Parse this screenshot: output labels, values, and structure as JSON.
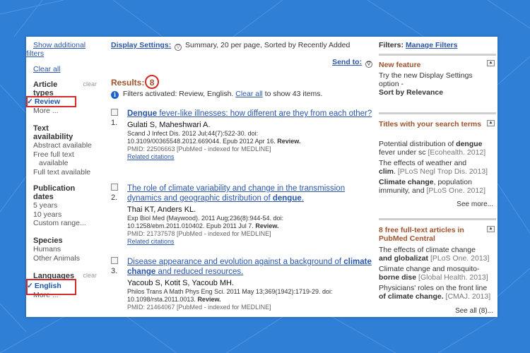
{
  "sidebar": {
    "show_additional": [
      "Show additional",
      "filters"
    ],
    "clear_all": "Clear all",
    "article_types": {
      "heading": [
        "Article",
        "types"
      ],
      "clear": "clear",
      "selected": "Review",
      "more": "More ..."
    },
    "text_availability": {
      "heading": [
        "Text",
        "availability"
      ],
      "items": [
        "Abstract available",
        "Free full text",
        "available",
        "Full text available"
      ]
    },
    "publication_dates": {
      "heading": [
        "Publication",
        "dates"
      ],
      "items": [
        "5 years",
        "10 years",
        "Custom range..."
      ]
    },
    "species": {
      "heading": "Species",
      "items": [
        "Humans",
        "Other Animals"
      ]
    },
    "languages": {
      "heading": "Languages",
      "clear": "clear",
      "selected": "English",
      "more": "More ..."
    },
    "check_mark": "✓"
  },
  "main": {
    "display_settings": {
      "label": "Display Settings:",
      "value": "Summary, 20 per page, Sorted by Recently Added"
    },
    "send_to": "Send to:",
    "results_label": "Results:",
    "results_count": "8",
    "filters_activated": "Filters activated: Review, English.",
    "clear_all": "Clear all",
    "show_all": "to show 43 items.",
    "results": [
      {
        "num": "1.",
        "title_html": "<b>Dengue</b> fever-like illnesses: how different are they from each other?",
        "authors": "Gulati S, Maheshwari A.",
        "cite1": "Scand J Infect Dis. 2012 Jul;44(7):522-30. doi:",
        "cite2": "10.3109/00365548.2012.669044. Epub 2012 Apr 16.",
        "cite_bold": "Review.",
        "pmid": "PMID: 22506663 [PubMed - indexed for MEDLINE]",
        "related": "Related citations"
      },
      {
        "num": "2.",
        "title_html": "The role of climate variability and change in the transmission dynamics and geographic distribution of <b>dengue</b>.",
        "authors": "Thai KT, Anders KL.",
        "cite1": "Exp Biol Med (Maywood). 2011 Aug;236(8):944-54. doi:",
        "cite2": "10.1258/ebm.2011.010402. Epub 2011 Jul 7.",
        "cite_bold": "Review.",
        "pmid": "PMID: 21737578 [PubMed - indexed for MEDLINE]",
        "related": "Related citations"
      },
      {
        "num": "3.",
        "title_html": "Disease appearance and evolution against a background of <b>climate change</b> and reduced resources.",
        "authors": "Yacoub S, Kotit S, Yacoub MH.",
        "cite1": "Philos Trans A Math Phys Eng Sci. 2011 May 13;369(1942):1719-29. doi:",
        "cite2": "10.1098/rsta.2011.0013.",
        "cite_bold": "Review.",
        "pmid": "PMID: 21464067 [PubMed - indexed for MEDLINE]",
        "related": ""
      }
    ]
  },
  "right": {
    "filters_label": "Filters:",
    "manage_filters": "Manage Filters",
    "new_feature": {
      "title": "New feature",
      "text": "Try the new Display Settings option -",
      "bold": "Sort by Relevance"
    },
    "titles_box": {
      "title": "Titles with your search terms",
      "items": [
        {
          "line1_pre": "Potential distribution of ",
          "line1_bold": "dengue",
          "line2": "fever under sc",
          "src": "[Ecohealth. 2012]"
        },
        {
          "line1_pre": "The effects of weather and",
          "line1_bold": "",
          "line2_bold": "clim",
          "line2": ".",
          "src": "[PLoS Negl Trop Dis. 2013]"
        },
        {
          "line1_pre": "",
          "line1_bold": "Climate change",
          "line1_post": ", population",
          "line2": "immunity, and",
          "src": "[PLoS One. 2012]"
        }
      ],
      "see_more": "See more..."
    },
    "free_box": {
      "title": "8 free full-text articles in PubMed Central",
      "items": [
        {
          "line1": "The effects of climate change",
          "line2_bold": "and globalizat",
          "src": "[PLoS One. 2013]"
        },
        {
          "line1": "Climate change and mosquito-",
          "line2_bold": "borne dise",
          "src": "[Global Health. 2013]"
        },
        {
          "line1": "Physicians' roles on the front line",
          "line2_bold": "of climate change.",
          "src": "[CMAJ. 2013]"
        }
      ],
      "see_all": "See all (8)..."
    },
    "collapse_glyph": "▲",
    "dropdown_glyph": "▽"
  },
  "info_glyph": "i",
  "colors": {
    "background": "#2f7fd6",
    "link": "#2a55a8",
    "heading_brown": "#a0522d",
    "highlight_red": "#d42a2a"
  }
}
